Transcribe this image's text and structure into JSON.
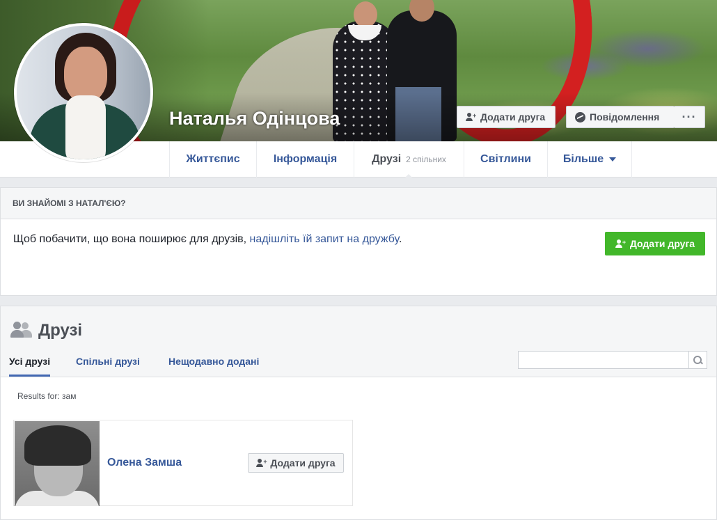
{
  "profile": {
    "name": "Наталья Одінцова",
    "add_friend_label": "Додати друга",
    "message_label": "Повідомлення",
    "more_label": "···"
  },
  "nav": {
    "items": [
      {
        "label": "Життєпис"
      },
      {
        "label": "Інформація"
      },
      {
        "label": "Друзі",
        "sub": "2 спільних"
      },
      {
        "label": "Світлини"
      },
      {
        "label": "Більше"
      }
    ]
  },
  "know_panel": {
    "heading": "ВИ ЗНАЙОМІ З НАТАЛ'ЄЮ?",
    "text": "Щоб побачити, що вона поширює для друзів, ",
    "link": "надішліть їй запит на дружбу",
    "text_end": ".",
    "button_label": "Додати друга"
  },
  "friends": {
    "title": "Друзі",
    "tabs": [
      "Усі друзі",
      "Спільні друзі",
      "Нещодавно додані"
    ],
    "search_value": "",
    "results_text": "Results for: зам",
    "cards": [
      {
        "name": "Олена Замша",
        "button_label": "Додати друга"
      }
    ]
  },
  "colors": {
    "link": "#365899",
    "green_button": "#42b72a",
    "active_tab": "#4267b2",
    "page_bg": "#e9ebee"
  },
  "icons": [
    "add-user-icon",
    "messenger-icon",
    "caret-down-icon",
    "friends-icon",
    "search-icon"
  ]
}
